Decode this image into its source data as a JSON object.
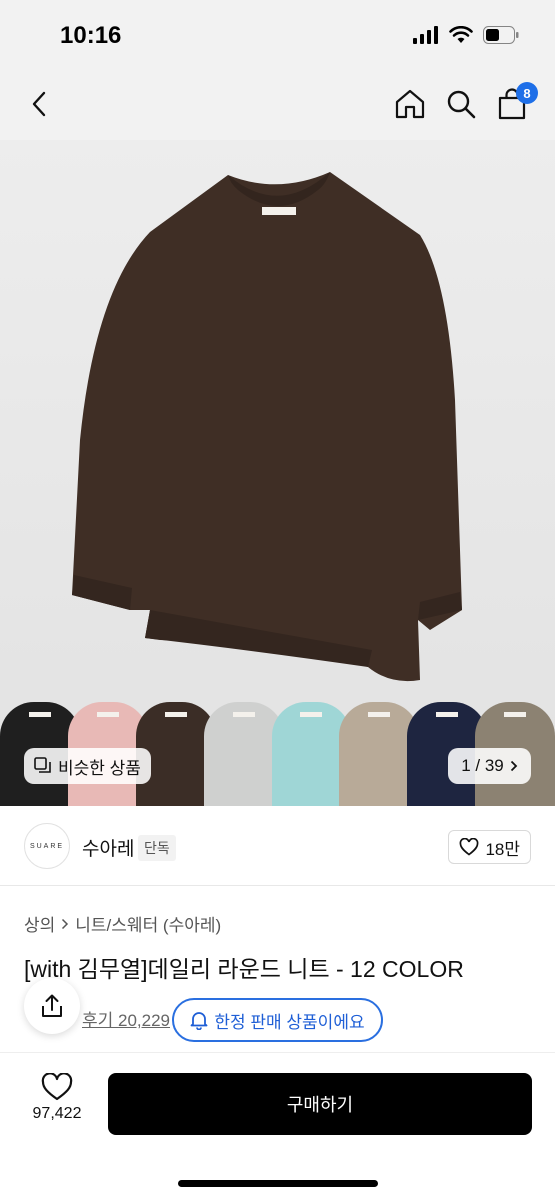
{
  "status_bar": {
    "time": "10:16"
  },
  "nav": {
    "cart_count": "8",
    "icons": [
      "back-icon",
      "home-icon",
      "search-icon",
      "cart-icon"
    ]
  },
  "hero": {
    "brand_tag": "SUARE",
    "similar_label": "비슷한 상품",
    "page_counter": "1 / 39",
    "swatch_colors": [
      "#1f1f1f",
      "#e8b9b6",
      "#3b2d26",
      "#cfd0cf",
      "#9fd6d6",
      "#b8aa98",
      "#1e2540",
      "#8c8272"
    ]
  },
  "store": {
    "logo_text": "SUARE",
    "name": "수아레",
    "tag": "단독",
    "likes": "18만"
  },
  "product": {
    "breadcrumb": [
      "상의",
      "니트/스웨터 (수아레)"
    ],
    "title": "[with 김무열]데일리 라운드 니트 - 12 COLOR",
    "review_text": "후기 20,229",
    "limited_label": "한정 판매 상품이에요"
  },
  "bottom": {
    "wish_count": "97,422",
    "buy_label": "구매하기"
  },
  "colors": {
    "accent": "#1e6fe8",
    "sweater": "#3f2e25"
  }
}
